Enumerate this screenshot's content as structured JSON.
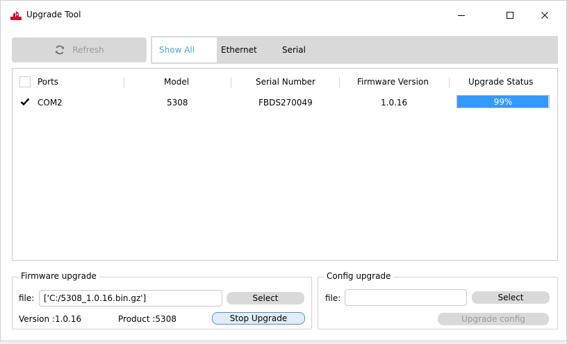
{
  "window": {
    "title": "Upgrade Tool",
    "accent_color": "#c8102e"
  },
  "toolbar": {
    "refresh_label": "Refresh",
    "refresh_icon": "refresh-icon",
    "tabs": [
      "Show All",
      "Ethernet",
      "Serial"
    ],
    "active_tab": "Show All"
  },
  "table": {
    "columns": [
      "Ports",
      "Model",
      "Serial Number",
      "Firmware Version",
      "Upgrade Status"
    ],
    "rows": [
      {
        "checked": true,
        "port": "COM2",
        "model": "5308",
        "serial_number": "FBDS270049",
        "firmware_version": "1.0.16",
        "upgrade_status": "99%",
        "progress": 0.99
      }
    ],
    "progress_color": "#3399ff"
  },
  "firmware_upgrade": {
    "title": "Firmware upgrade",
    "file_label": "file:",
    "file_value": "['C:/5308_1.0.16.bin.gz']",
    "select_label": "Select",
    "version_text": "Version :1.0.16",
    "product_text": "Product :5308",
    "stop_label": "Stop Upgrade"
  },
  "config_upgrade": {
    "title": "Config upgrade",
    "file_label": "file:",
    "file_value": "",
    "select_label": "Select",
    "upgrade_config_label": "Upgrade config"
  }
}
